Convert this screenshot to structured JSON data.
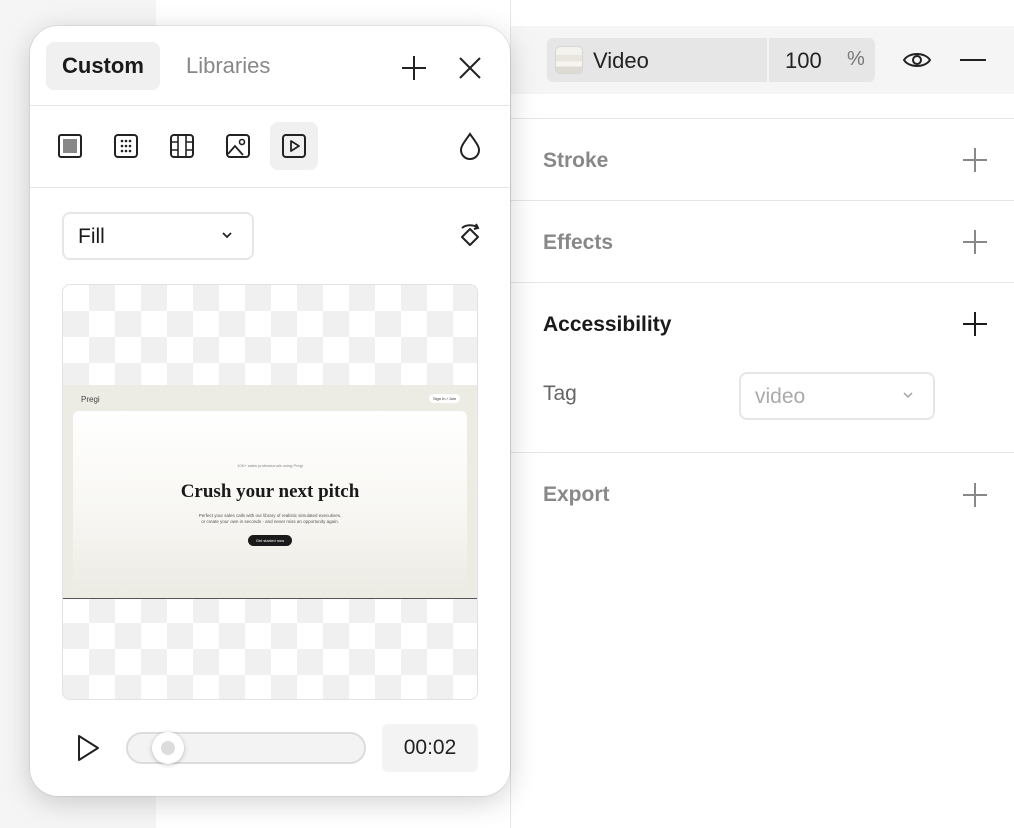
{
  "fill": {
    "name": "Video",
    "opacity": "100",
    "opacity_unit": "%"
  },
  "sections": {
    "stroke": "Stroke",
    "effects": "Effects",
    "accessibility": "Accessibility",
    "export": "Export"
  },
  "accessibility": {
    "tag_label": "Tag",
    "tag_value": "video"
  },
  "popup": {
    "tabs": [
      "Custom",
      "Libraries"
    ],
    "mode": "Fill",
    "preview": {
      "logo": "Pregi",
      "signin": "Sign In / Join",
      "social_proof": "10K+ sales professionals using Pregi",
      "headline": "Crush your next pitch",
      "sub1": "Perfect your sales calls with our library of realistic simulated executives,",
      "sub2": "or create your own in seconds - and never miss an opportunity again.",
      "cta": "Get started now"
    },
    "playback": {
      "time": "00:02",
      "progress": 0.05
    }
  },
  "icons": {
    "type_buttons": [
      "solid-fill-icon",
      "gradient-fill-icon",
      "pattern-fill-icon",
      "image-fill-icon",
      "video-fill-icon"
    ],
    "colors": {
      "accent": "#1a1a1a",
      "muted": "#888888",
      "chip": "#e6e6e6"
    }
  }
}
